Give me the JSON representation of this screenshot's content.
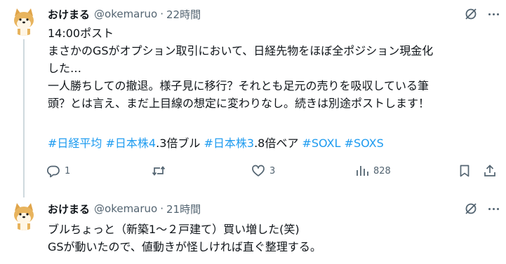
{
  "tweets": [
    {
      "author_name": "おけまる",
      "handle": "@okemaruo",
      "separator": "·",
      "time": "22時間",
      "lines": [
        "14:00ポスト",
        "まさかのGSがオプション取引において、日経先物をほぼ全ポジション現金化",
        "した…",
        "一人勝ちしての撤退。様子見に移行？それとも足元の売りを吸収している筆",
        "頭？とは言え、まだ上目線の想定に変わりなし。続きは別途ポストします！"
      ],
      "tags_line": [
        {
          "text": "#日経平均",
          "type": "tag"
        },
        {
          "text": " ",
          "type": "plain"
        },
        {
          "text": "#日本株4",
          "type": "tag"
        },
        {
          "text": ".3倍ブル ",
          "type": "plain"
        },
        {
          "text": "#日本株3",
          "type": "tag"
        },
        {
          "text": ".8倍ベア ",
          "type": "plain"
        },
        {
          "text": "#SOXL",
          "type": "tag"
        },
        {
          "text": " ",
          "type": "plain"
        },
        {
          "text": "#SOXS",
          "type": "tag"
        }
      ],
      "actions": {
        "reply_count": "1",
        "retweet_count": "",
        "like_count": "3",
        "view_count": "828"
      }
    },
    {
      "author_name": "おけまる",
      "handle": "@okemaruo",
      "separator": "·",
      "time": "21時間",
      "lines": [
        "ブルちょっと（新築1～２戸建て）買い増した(笑)",
        "GSが動いたので、値動きが怪しければ直ぐ整理する。"
      ]
    }
  ],
  "icons": {
    "avatar": "shiba-dog-avatar",
    "grok": "grok-icon",
    "more": "more-icon",
    "reply": "reply-icon",
    "retweet": "retweet-icon",
    "like": "heart-icon",
    "views": "views-icon",
    "bookmark": "bookmark-icon",
    "share": "share-icon"
  },
  "colors": {
    "text": "#0f1419",
    "secondary": "#536471",
    "link": "#1d9bf0",
    "thread_line": "#cfd9de"
  }
}
